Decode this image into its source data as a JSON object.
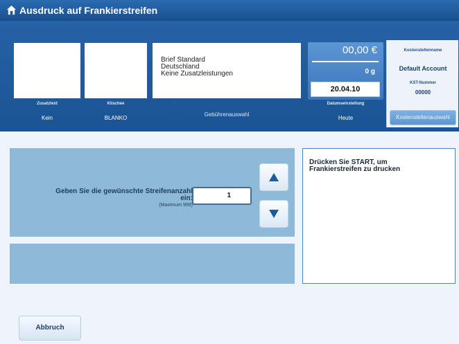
{
  "window": {
    "title": "Ausdruck auf Frankierstreifen",
    "icon": "home-icon"
  },
  "fields": {
    "zusatztext": {
      "label": "Zusatztext",
      "value": "Kein"
    },
    "klischee": {
      "label": "Klischee",
      "value": "BLANKO"
    },
    "gebuehren": {
      "label": "Gebührenauswahl",
      "lines": [
        "Brief Standard",
        "Deutschland",
        "Keine Zusatzleistungen"
      ]
    },
    "datum": {
      "label": "Datumseinstellung",
      "value": "Heute",
      "date": "20.04.10"
    }
  },
  "price": {
    "amount": "00,00 €",
    "weight": "0 g"
  },
  "account": {
    "name_label": "Kostenstellenname",
    "name_value": "Default Account",
    "number_label": "KST-Nummer",
    "number_value": "00000",
    "button_label": "Kostenstellenauswahl"
  },
  "count": {
    "label_line1": "Geben Sie die gewünschte Streifenanzahl",
    "label_line2": "ein:",
    "hint": "(Maximum 999)",
    "value": "1"
  },
  "message": {
    "line1": "Drücken Sie  START, um",
    "line2": "Frankierstreifen zu drucken"
  },
  "buttons": {
    "cancel": "Abbruch"
  },
  "colors": {
    "titlebar": "#1f5c9f",
    "band": "#2160a4",
    "panel": "#8ebad8",
    "accent_price": "#4c86c6"
  }
}
